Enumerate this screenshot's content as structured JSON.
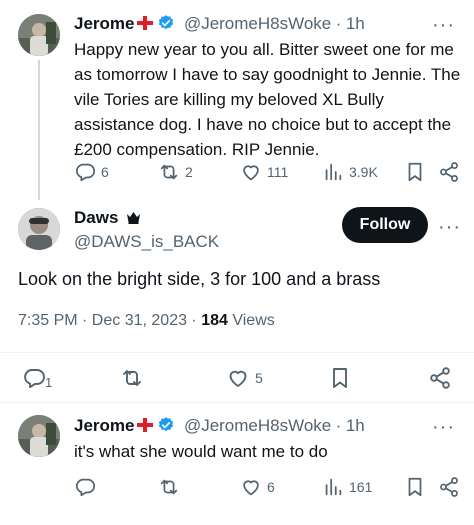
{
  "tweet1": {
    "name": "Jerome",
    "handle": "@JeromeH8sWoke",
    "sep": "·",
    "time": "1h",
    "text": "Happy new year to you all. Bitter sweet one for me as tomorrow I have to say goodnight to Jennie. The vile Tories are killing my beloved XL Bully assistance dog. I have no choice but to accept the £200 compensation. RIP Jennie.",
    "replies": "6",
    "retweets": "2",
    "likes": "111",
    "views": "3.9K"
  },
  "main": {
    "name": "Daws",
    "handle": "@DAWS_is_BACK",
    "follow_label": "Follow",
    "text": "Look on the bright side, 3 for 100 and a brass",
    "timestamp": "7:35 PM · Dec 31, 2023 · ",
    "views_count": "184",
    "views_label": "Views",
    "replies": "1",
    "likes": "5"
  },
  "tweet2": {
    "name": "Jerome",
    "handle": "@JeromeH8sWoke",
    "sep": "·",
    "time": "1h",
    "text": "it's what she would want me to do",
    "likes": "6",
    "views": "161"
  },
  "colors": {
    "verified": "#1d9bf0",
    "flag_red": "#e11d2a",
    "muted": "#536471",
    "button": "#0f1419"
  },
  "icons": [
    "reply-icon",
    "retweet-icon",
    "like-icon",
    "views-icon",
    "bookmark-icon",
    "share-icon",
    "more-icon",
    "verified-badge-icon",
    "crown-icon",
    "england-flag-icon"
  ]
}
